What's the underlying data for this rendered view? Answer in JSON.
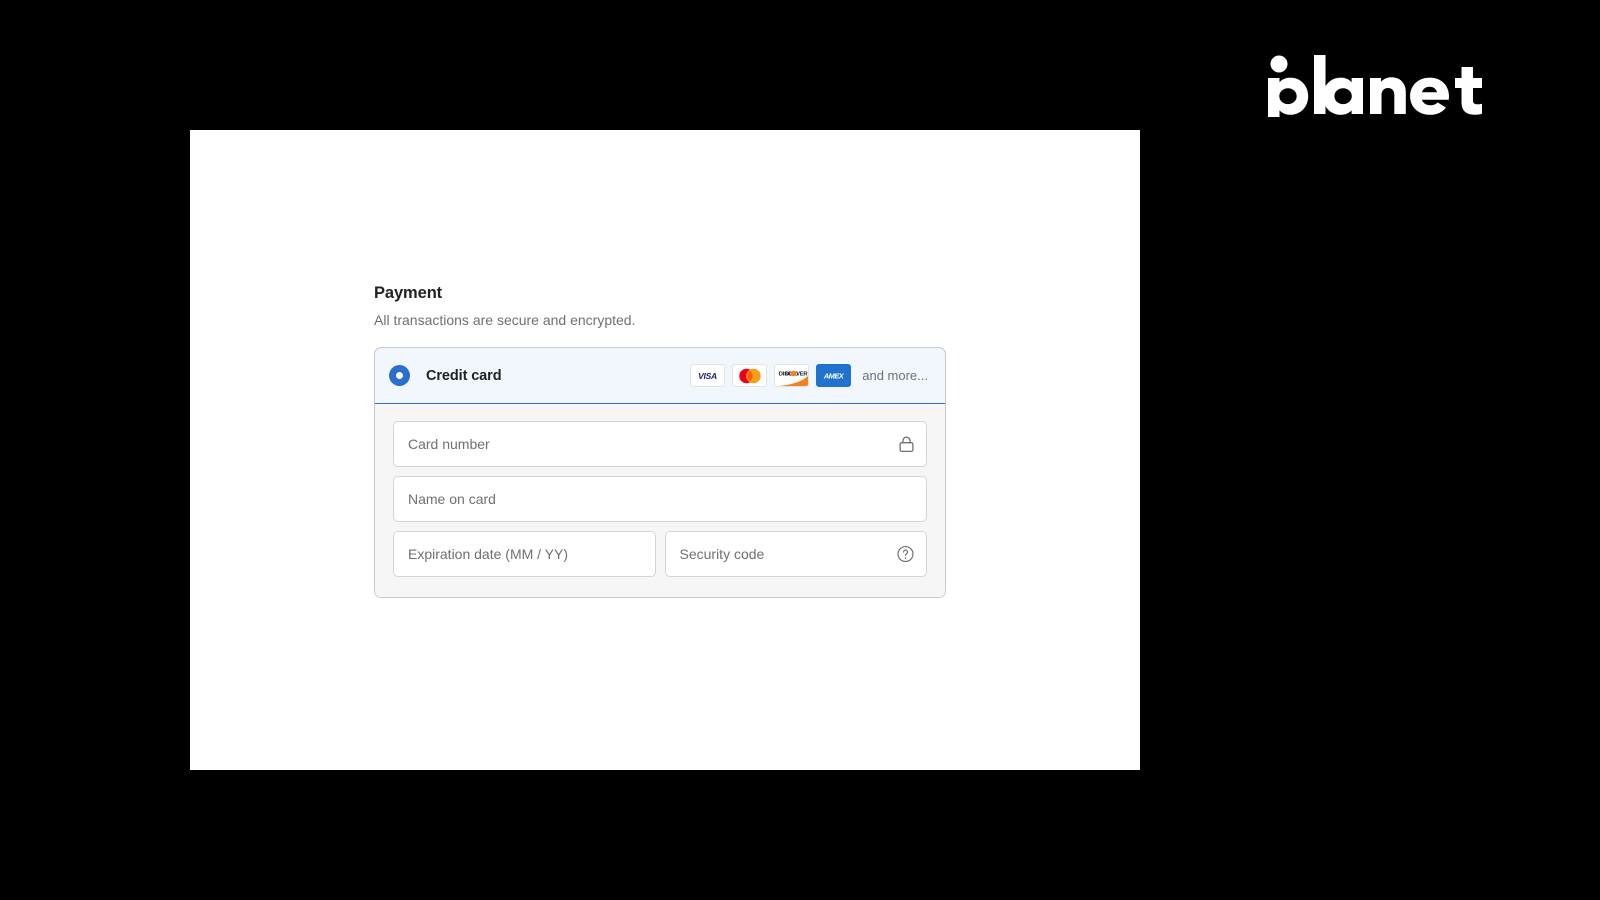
{
  "brand": {
    "name": "planet",
    "logo_icon": "planet-wordmark",
    "color": "#ffffff"
  },
  "payment": {
    "title": "Payment",
    "subtitle": "All transactions are secure and encrypted.",
    "method": {
      "label": "Credit card",
      "selected": true,
      "radio_icon": "radio-selected-icon",
      "accent_color": "#2c6ecb",
      "header_background": "#f1f7fd",
      "accepted_cards": [
        {
          "name": "visa",
          "label": "VISA"
        },
        {
          "name": "mastercard",
          "label": "Mastercard"
        },
        {
          "name": "discover",
          "label": "DISCOVER"
        },
        {
          "name": "amex",
          "label": "AMEX"
        }
      ],
      "more_label": "and more..."
    },
    "fields": {
      "card_number": {
        "placeholder": "Card number",
        "value": "",
        "icon": "lock-icon"
      },
      "name_on_card": {
        "placeholder": "Name on card",
        "value": ""
      },
      "expiration_date": {
        "placeholder": "Expiration date (MM / YY)",
        "value": ""
      },
      "security_code": {
        "placeholder": "Security code",
        "value": "",
        "icon": "help-circle-icon"
      }
    }
  }
}
